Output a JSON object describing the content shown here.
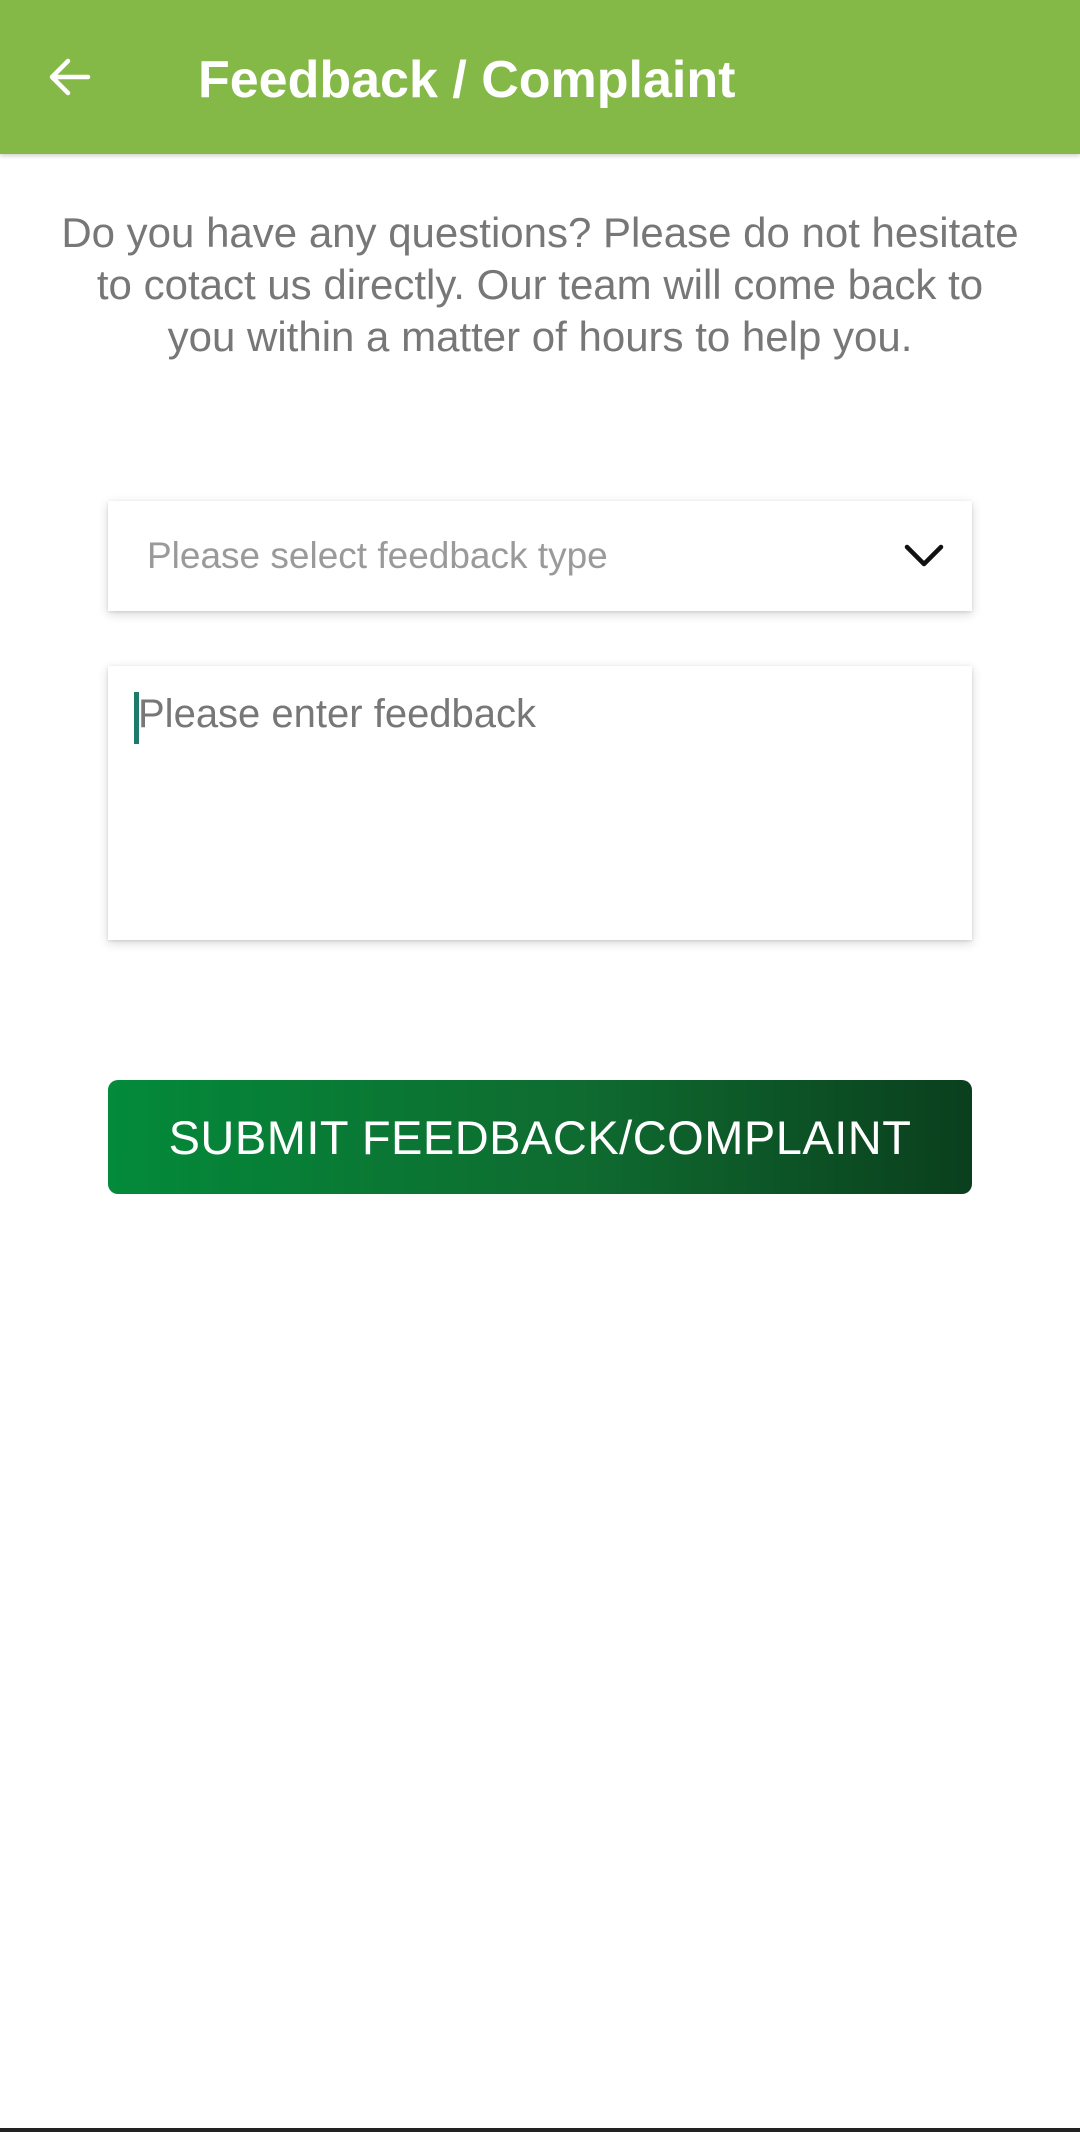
{
  "app_bar": {
    "title": "Feedback / Complaint",
    "back_icon": "arrow-left-icon",
    "background_color": "#84b947"
  },
  "intro": {
    "text": "Do you have any questions? Please do not hesitate to cotact us directly. Our team will come back to you within a matter of hours to help you."
  },
  "feedback_type_select": {
    "placeholder": "Please select feedback type",
    "icon": "chevron-down-icon"
  },
  "feedback_input": {
    "placeholder": "Please enter feedback",
    "value": ""
  },
  "submit_button": {
    "label": "SUBMIT FEEDBACK/COMPLAINT",
    "gradient_start": "#038a3a",
    "gradient_end": "#0a3f1d"
  }
}
